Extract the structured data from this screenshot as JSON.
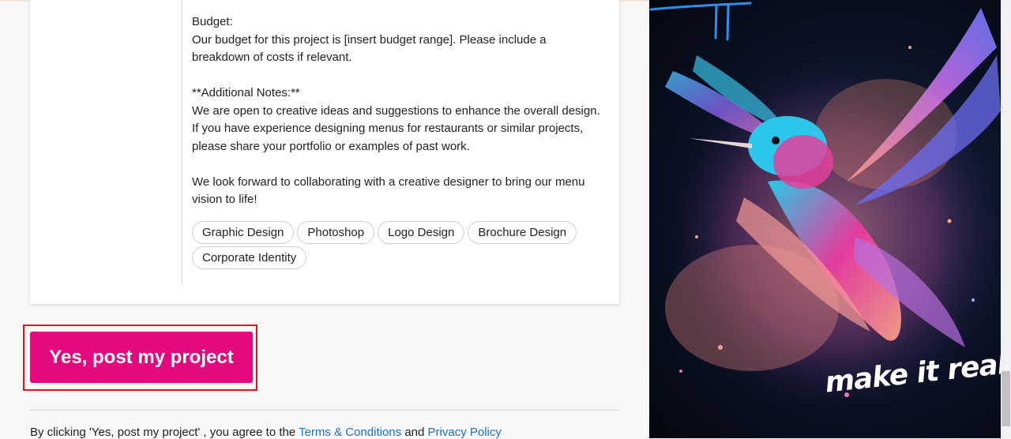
{
  "project": {
    "description": [
      "Budget:",
      "Our budget for this project is [insert budget range]. Please include a breakdown of costs if relevant.",
      "",
      "**Additional Notes:**",
      "We are open to creative ideas and suggestions to enhance the overall design. If you have experience designing menus for restaurants or similar projects, please share your portfolio or examples of past work.",
      "",
      "We look forward to collaborating with a creative designer to bring our menu vision to life!"
    ],
    "skills": [
      "Graphic Design",
      "Photoshop",
      "Logo Design",
      "Brochure Design",
      "Corporate Identity"
    ]
  },
  "post_button": {
    "label": "Yes, post my project",
    "color": "#e5097f"
  },
  "highlight_color": "#e0131f",
  "agreement": {
    "prefix": "By clicking 'Yes, post my project' , you agree to the",
    "terms_link": "Terms & Conditions",
    "conjunction": "and",
    "privacy_link": "Privacy Policy"
  },
  "promo": {
    "tagline": "make it real.",
    "image": "hummingbird-illustration"
  }
}
